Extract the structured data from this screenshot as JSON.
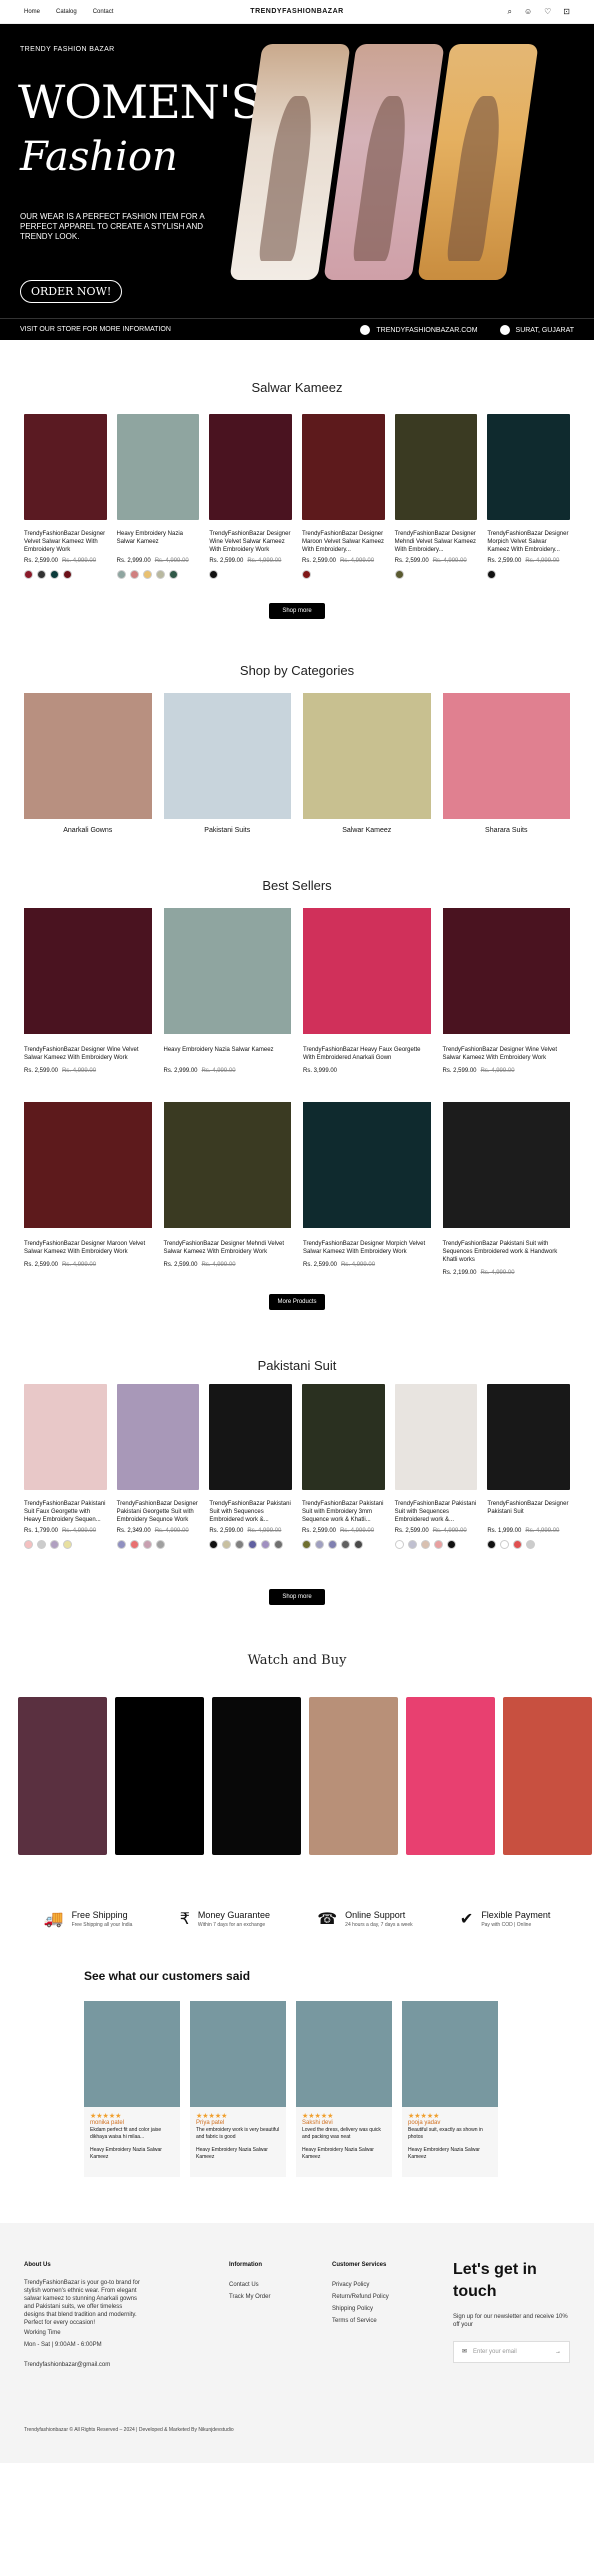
{
  "header": {
    "nav": [
      "Home",
      "Catalog",
      "Contact"
    ],
    "brand": "TRENDYFASHIONBAZAR"
  },
  "hero": {
    "tag": "TRENDY FASHION BAZAR",
    "title1": "WOMEN'S",
    "title2": "Fashion",
    "desc": "OUR WEAR IS A PERFECT FASHION ITEM FOR A PERFECT APPAREL TO CREATE A STYLISH AND TRENDY LOOK.",
    "cta": "ORDER NOW!",
    "strip_left": "VISIT OUR STORE FOR MORE INFORMATION",
    "strip_site": "TRENDYFASHIONBAZAR.COM",
    "strip_loc": "SURAT, GUJARAT"
  },
  "salwar": {
    "title": "Salwar Kameez",
    "button": "Shop more",
    "products": [
      {
        "name": "TrendyFashionBazar Designer Velvet Salwar Kameez With Embroidery Work",
        "price": "Rs. 2,599.00",
        "old": "Rs. 4,999.00",
        "img": "#5a1a22"
      },
      {
        "name": "Heavy Embroidery Nazia Salwar Kameez",
        "price": "Rs. 2,999.00",
        "old": "Rs. 4,999.00",
        "img": "#8fa5a0"
      },
      {
        "name": "TrendyFashionBazar Designer Wine Velvet Salwar Kameez With Embroidery Work",
        "price": "Rs. 2,599.00",
        "old": "Rs. 4,999.00",
        "img": "#4a1320"
      },
      {
        "name": "TrendyFashionBazar Designer Maroon Velvet Salwar Kameez With Embroidery...",
        "price": "Rs. 2,599.00",
        "old": "Rs. 4,999.00",
        "img": "#5d1a1c"
      },
      {
        "name": "TrendyFashionBazar Designer Mehndi Velvet Salwar Kameez With Embroidery...",
        "price": "Rs. 2,599.00",
        "old": "Rs. 4,999.00",
        "img": "#3a3a22"
      },
      {
        "name": "TrendyFashionBazar Designer Morpich Velvet Salwar Kameez With Embroidery...",
        "price": "Rs. 2,599.00",
        "old": "Rs. 4,999.00",
        "img": "#0f2a2e"
      }
    ]
  },
  "categories": {
    "title": "Shop by Categories",
    "items": [
      {
        "label": "Anarkali Gowns",
        "img": "#b89080"
      },
      {
        "label": "Pakistani Suits",
        "img": "#c8d4dc"
      },
      {
        "label": "Salwar Kameez",
        "img": "#c8c090"
      },
      {
        "label": "Sharara Suits",
        "img": "#e08090"
      }
    ]
  },
  "best": {
    "title": "Best Sellers",
    "button": "More Products",
    "products": [
      {
        "name": "TrendyFashionBazar Designer Wine Velvet Salwar Kameez With Embroidery Work",
        "price": "Rs. 2,599.00",
        "old": "Rs. 4,999.00",
        "img": "#4a1320"
      },
      {
        "name": "Heavy Embroidery Nazia Salwar Kameez",
        "price": "Rs. 2,999.00",
        "old": "Rs. 4,999.00",
        "img": "#8fa5a0"
      },
      {
        "name": "TrendyFashionBazar Heavy Faux Georgette With Embroidered Anarkali Gown",
        "price": "Rs. 3,999.00",
        "old": "",
        "img": "#d0305a"
      },
      {
        "name": "TrendyFashionBazar Designer Wine Velvet Salwar Kameez With Embroidery Work",
        "price": "Rs. 2,599.00",
        "old": "Rs. 4,999.00",
        "img": "#4a1320"
      },
      {
        "name": "TrendyFashionBazar Designer Maroon Velvet Salwar Kameez With Embroidery Work",
        "price": "Rs. 2,599.00",
        "old": "Rs. 4,999.00",
        "img": "#5d1a1c"
      },
      {
        "name": "TrendyFashionBazar Designer Mehndi Velvet Salwar Kameez With Embroidery Work",
        "price": "Rs. 2,599.00",
        "old": "Rs. 4,999.00",
        "img": "#3a3a22"
      },
      {
        "name": "TrendyFashionBazar Designer Morpich Velvet Salwar Kameez With Embroidery Work",
        "price": "Rs. 2,599.00",
        "old": "Rs. 4,999.00",
        "img": "#0f2a2e"
      },
      {
        "name": "TrendyFashionBazar Pakistani Suit with Sequences Embroidered work & Handwork Khatli works",
        "price": "Rs. 2,199.00",
        "old": "Rs. 4,999.00",
        "img": "#1c1c1c"
      }
    ]
  },
  "pakistani": {
    "title": "Pakistani Suit",
    "button": "Shop more",
    "products": [
      {
        "name": "TrendyFashionBazar Pakistani Suit Faux Georgette with Heavy Embroidery Sequen...",
        "price": "Rs. 1,799.00",
        "old": "Rs. 4,999.00",
        "img": "#e8c8c8"
      },
      {
        "name": "TrendyFashionBazar Designer Pakistani Georgette Suit with Embroidery Sequnce Work",
        "price": "Rs. 2,349.00",
        "old": "Rs. 4,999.00",
        "img": "#a898b8"
      },
      {
        "name": "TrendyFashionBazar Pakistani Suit with Sequences Embroidered work &...",
        "price": "Rs. 2,599.00",
        "old": "Rs. 4,999.00",
        "img": "#151515"
      },
      {
        "name": "TrendyFashionBazar Pakistani Suit with Embroidery 3mm Sequence work & Khatli...",
        "price": "Rs. 2,599.00",
        "old": "Rs. 4,999.00",
        "img": "#2a3020"
      },
      {
        "name": "TrendyFashionBazar Pakistani Suit with Sequences Embroidered work &...",
        "price": "Rs. 2,599.00",
        "old": "Rs. 4,999.00",
        "img": "#e8e4e0"
      },
      {
        "name": "TrendyFashionBazar Designer Pakistani Suit",
        "price": "Rs. 1,999.00",
        "old": "Rs. 4,999.00",
        "img": "#181818"
      }
    ]
  },
  "watch": {
    "title": "Watch and Buy",
    "videos": [
      "#5a3040",
      "#000000",
      "#080808",
      "#b89078",
      "#e84070",
      "#c85040"
    ]
  },
  "features": [
    {
      "icon": "truck-icon",
      "title": "Free Shipping",
      "sub": "Free Shipping all your India"
    },
    {
      "icon": "money-icon",
      "title": "Money Guarantee",
      "sub": "Within 7 days for an exchange"
    },
    {
      "icon": "support-icon",
      "title": "Online Support",
      "sub": "24 hours a day, 7 days a week"
    },
    {
      "icon": "payment-icon",
      "title": "Flexible Payment",
      "sub": "Pay with COD | Online"
    }
  ],
  "reviews": {
    "title": "See what our customers said",
    "items": [
      {
        "name": "monika patel",
        "text": "Ekdam perfect fit and color jaise dikhaya waisa hi milaa...",
        "img": "#7898a0"
      },
      {
        "name": "Priya patel",
        "text": "The embroidery work is very beautiful and fabric is good",
        "img": "#7898a0"
      },
      {
        "name": "Sakshi devi",
        "text": "Loved the dress, delivery was quick and packing was neat",
        "img": "#7898a0"
      },
      {
        "name": "pooja yadav",
        "text": "Beautiful suit, exactly as shown in photos",
        "img": "#7898a0"
      }
    ],
    "product": "Heavy Embroidery Nazia Salwar Kameez"
  },
  "footer": {
    "about_h": "About Us",
    "about": "TrendyFashionBazar is your go-to brand for stylish women's ethnic wear. From elegant salwar kameez to stunning Anarkali gowns and Pakistani suits, we offer timeless designs that blend tradition and modernity. Perfect for every occasion!",
    "hours": "Working Time",
    "hours_v": "Mon - Sat | 9:00AM - 6:00PM",
    "email": "Trendyfashionbazar@gmail.com",
    "info_h": "Information",
    "info": [
      "Contact Us",
      "Track My Order"
    ],
    "cs_h": "Customer Services",
    "cs": [
      "Privacy Policy",
      "Return/Refund Policy",
      "Shipping Policy",
      "Terms of Service"
    ],
    "touch": "Let's get in touch",
    "touch_sub": "Sign up for our newsletter and receive 10% off your",
    "email_ph": "Enter your email",
    "copyright": "Trendyfashionbazar © All Rights Reserved – 2024 | Developed & Marketed By Nikunjdevstudio"
  }
}
